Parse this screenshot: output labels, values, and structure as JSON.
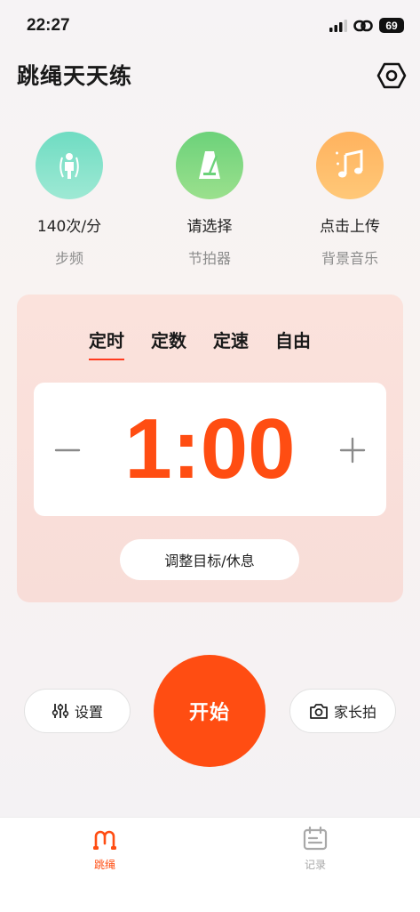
{
  "status_bar": {
    "time": "22:27",
    "battery": "69"
  },
  "header": {
    "title": "跳绳天天练"
  },
  "tools": [
    {
      "main": "140次/分",
      "sub": "步频",
      "icon": "jump-rope-person-icon"
    },
    {
      "main": "请选择",
      "sub": "节拍器",
      "icon": "metronome-icon"
    },
    {
      "main": "点击上传",
      "sub": "背景音乐",
      "icon": "music-note-icon"
    }
  ],
  "modes": [
    "定时",
    "定数",
    "定速",
    "自由"
  ],
  "active_mode": "定时",
  "timer": {
    "value": "1:00"
  },
  "adjust_label": "调整目标/休息",
  "actions": {
    "settings": "设置",
    "start": "开始",
    "parent_photo": "家长拍"
  },
  "tabs": [
    {
      "label": "跳绳",
      "active": true
    },
    {
      "label": "记录",
      "active": false
    }
  ],
  "colors": {
    "accent": "#ff4d12",
    "tab_inactive": "#a8a8a8"
  }
}
